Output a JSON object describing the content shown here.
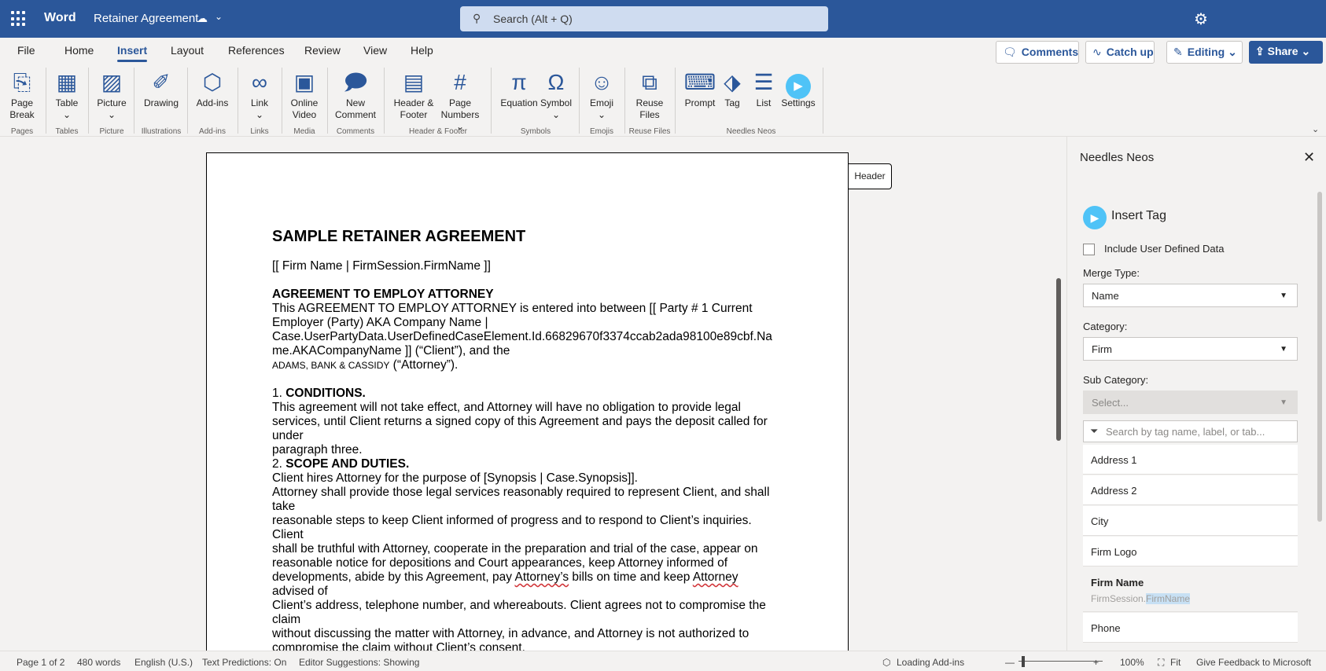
{
  "app": {
    "name": "Word",
    "doc_title": "Retainer Agreement",
    "search_placeholder": "Search (Alt + Q)"
  },
  "tabs": [
    "File",
    "Home",
    "Insert",
    "Layout",
    "References",
    "Review",
    "View",
    "Help"
  ],
  "active_tab": "Insert",
  "top_buttons": {
    "comments": "Comments",
    "catchup": "Catch up",
    "editing": "Editing",
    "share": "Share"
  },
  "ribbon": {
    "buttons": [
      {
        "l1": "Page",
        "l2": "Break"
      },
      {
        "l1": "Table",
        "l2": "⌄"
      },
      {
        "l1": "Picture",
        "l2": "⌄"
      },
      {
        "l1": "Drawing",
        "l2": ""
      },
      {
        "l1": "Add-ins",
        "l2": ""
      },
      {
        "l1": "Link",
        "l2": "⌄"
      },
      {
        "l1": "Online",
        "l2": "Video"
      },
      {
        "l1": "New",
        "l2": "Comment"
      },
      {
        "l1": "Header &",
        "l2": "Footer"
      },
      {
        "l1": "Page",
        "l2": "Numbers ⌄"
      },
      {
        "l1": "Equation",
        "l2": ""
      },
      {
        "l1": "Symbol",
        "l2": "⌄"
      },
      {
        "l1": "Emoji",
        "l2": "⌄"
      },
      {
        "l1": "Reuse",
        "l2": "Files"
      },
      {
        "l1": "Prompt",
        "l2": ""
      },
      {
        "l1": "Tag",
        "l2": ""
      },
      {
        "l1": "List",
        "l2": ""
      },
      {
        "l1": "Settings",
        "l2": ""
      }
    ],
    "groups": [
      "Pages",
      "Tables",
      "Picture",
      "Illustrations",
      "Add-ins",
      "Links",
      "Media",
      "Comments",
      "Header & Footer",
      "Symbols",
      "Emojis",
      "Reuse Files",
      "Needles Neos"
    ]
  },
  "document": {
    "header_tag": "Header",
    "title": "SAMPLE RETAINER AGREEMENT",
    "firm_line": "[[ Firm Name | FirmSession.FirmName ]]",
    "sec0_heading": "AGREEMENT TO EMPLOY ATTORNEY",
    "sec0_l1": "This AGREEMENT TO EMPLOY ATTORNEY is entered into between [[ Party # 1 Current",
    "sec0_l2": "Employer (Party) AKA Company Name |",
    "sec0_l3": "Case.UserPartyData.UserDefinedCaseElement.Id.66829670f3374ccab2ada98100e89cbf.Na",
    "sec0_l4": "me.AKACompanyName ]] (“Client”), and the",
    "sec0_firm_small": "ADAMS, BANK & CASSIDY",
    "sec0_attorney": " (“Attorney”).",
    "sec1_num": "1. ",
    "sec1_heading": "CONDITIONS.",
    "sec1_l1": "This agreement will not take effect, and Attorney will have no obligation to provide legal",
    "sec1_l2": "services, until Client returns a signed copy of this Agreement and pays the deposit called for",
    "sec1_l3": "under",
    "sec1_l4": "paragraph three.",
    "sec2_num": "2. ",
    "sec2_heading": "SCOPE AND DUTIES.",
    "sec2_l1": "Client hires Attorney for the purpose of [Synopsis | Case.Synopsis]].",
    "sec2_l2": "Attorney shall provide those legal services reasonably required to represent Client, and shall",
    "sec2_l3": "take",
    "sec2_l4": "reasonable steps to keep Client informed of progress and to respond to Client’s inquiries.",
    "sec2_l5": "Client",
    "sec2_l6": "shall be truthful with Attorney, cooperate in the preparation and trial of the case, appear on",
    "sec2_l7": "reasonable notice for depositions and Court appearances, keep Attorney informed of",
    "sec2_l8a": "developments, abide by this Agreement, pay ",
    "sec2_l8b": "Attorney’s",
    "sec2_l8c": " bills on time and keep ",
    "sec2_l8d": "Attorney",
    "sec2_l9": "advised of",
    "sec2_l10": "Client’s address, telephone number, and whereabouts. Client agrees not to compromise the",
    "sec2_l11": "claim",
    "sec2_l12": "without discussing the matter with Attorney, in advance, and Attorney is not authorized to",
    "sec2_l13": "compromise the claim without Client’s consent."
  },
  "pane": {
    "title": "Needles Neos",
    "insert_tag": "Insert Tag",
    "include_udd": "Include User Defined Data",
    "merge_type_label": "Merge Type:",
    "merge_type_value": "Name",
    "category_label": "Category:",
    "category_value": "Firm",
    "subcategory_label": "Sub Category:",
    "subcategory_placeholder": "Select...",
    "tag_search_placeholder": "Search by tag name, label, or tab...",
    "tags": [
      {
        "name": "Address 1"
      },
      {
        "name": "Address 2"
      },
      {
        "name": "City"
      },
      {
        "name": "Firm Logo"
      },
      {
        "name": "Firm Name",
        "sub_prefix": "FirmSession.",
        "sub_hl": "FirmName"
      },
      {
        "name": "Phone"
      }
    ]
  },
  "status": {
    "page": "Page 1 of 2",
    "words": "480 words",
    "language": "English (U.S.)",
    "predictions": "Text Predictions: On",
    "editor": "Editor Suggestions: Showing",
    "addins": "Loading Add-ins",
    "zoom": "100%",
    "fit": "Fit",
    "feedback": "Give Feedback to Microsoft"
  }
}
